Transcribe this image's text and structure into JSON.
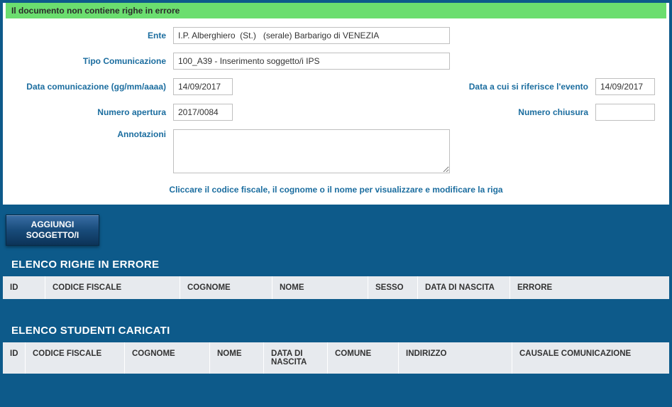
{
  "status": {
    "message": "Il documento non contiene righe in errore"
  },
  "form": {
    "ente_label": "Ente",
    "ente_value": "I.P. Alberghiero  (St.)   (serale) Barbarigo di VENEZIA",
    "tipo_label": "Tipo Comunicazione",
    "tipo_value": "100_A39 - Inserimento soggetto/i IPS",
    "data_com_label": "Data comunicazione (gg/mm/aaaa)",
    "data_com_value": "14/09/2017",
    "data_evento_label": "Data a cui si riferisce l'evento",
    "data_evento_value": "14/09/2017",
    "num_apertura_label": "Numero apertura",
    "num_apertura_value": "2017/0084",
    "num_chiusura_label": "Numero chiusura",
    "num_chiusura_value": "",
    "annotazioni_label": "Annotazioni",
    "annotazioni_value": "",
    "hint": "Cliccare il codice fiscale, il cognome o il nome per visualizzare e modificare la riga"
  },
  "buttons": {
    "aggiungi_line1": "AGGIUNGI",
    "aggiungi_line2": "SOGGETTO/I"
  },
  "section_errori": {
    "title": "ELENCO RIGHE IN ERRORE",
    "headers": {
      "id": "ID",
      "cf": "CODICE FISCALE",
      "cognome": "COGNOME",
      "nome": "NOME",
      "sesso": "SESSO",
      "data_nascita": "DATA DI NASCITA",
      "errore": "ERRORE"
    },
    "rows": []
  },
  "section_caricati": {
    "title": "ELENCO STUDENTI CARICATI",
    "headers": {
      "id": "ID",
      "cf": "CODICE FISCALE",
      "cognome": "COGNOME",
      "nome": "NOME",
      "data_nascita": "DATA DI NASCITA",
      "comune": "COMUNE",
      "indirizzo": "INDIRIZZO",
      "causale": "CAUSALE COMUNICAZIONE"
    },
    "rows": []
  }
}
